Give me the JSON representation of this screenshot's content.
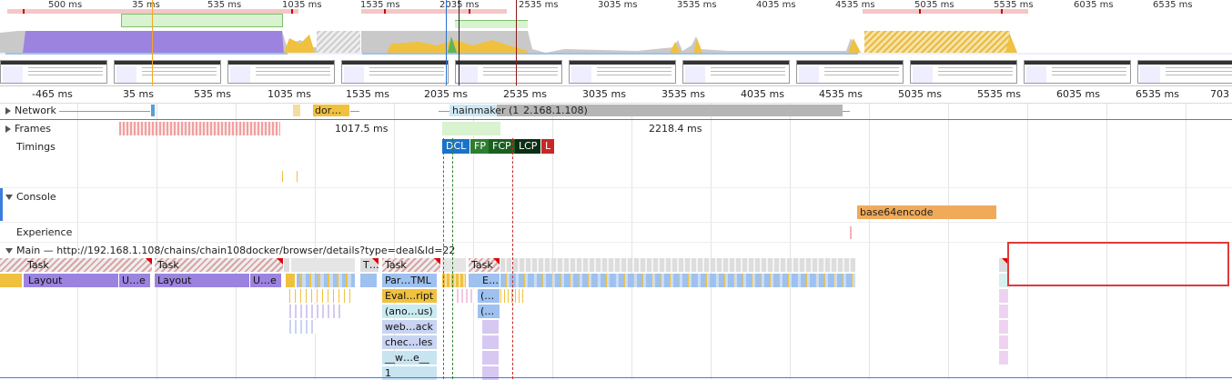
{
  "overview": {
    "ticks": [
      "500 ms",
      "35 ms",
      "535 ms",
      "1035 ms",
      "1535 ms",
      "2035 ms",
      "2535 ms",
      "3035 ms",
      "3535 ms",
      "4035 ms",
      "4535 ms",
      "5035 ms",
      "5535 ms",
      "6035 ms",
      "6535 ms"
    ]
  },
  "ruler": {
    "ticks": [
      "-465 ms",
      "35 ms",
      "535 ms",
      "1035 ms",
      "1535 ms",
      "2035 ms",
      "2535 ms",
      "3035 ms",
      "3535 ms",
      "4035 ms",
      "4535 ms",
      "5035 ms",
      "5535 ms",
      "6035 ms",
      "6535 ms",
      "703"
    ]
  },
  "tracks": {
    "network": {
      "label": "Network",
      "req1": "dor…",
      "req2": "hainmaker (1",
      "req3": "2.168.1.108)"
    },
    "frames": {
      "label": "Frames",
      "frame1": "1017.5 ms",
      "frame2": "2218.4 ms"
    },
    "timings": {
      "label": "Timings",
      "markers": [
        {
          "label": "DCL",
          "color": "#1a73c9"
        },
        {
          "label": "FP",
          "color": "#2e7d32"
        },
        {
          "label": "FCP",
          "color": "#1b5e20"
        },
        {
          "label": "LCP",
          "color": "#0d2e14"
        },
        {
          "label": "L",
          "color": "#c62828"
        }
      ]
    },
    "console": {
      "label": "Console",
      "event": "base64encode"
    },
    "experience": {
      "label": "Experience"
    },
    "main": {
      "label": "Main — http://192.168.1.108/chains/chain108docker/browser/details?type=deal&Id=22"
    }
  },
  "flame": {
    "task1": "Task",
    "task2": "Task",
    "task3": "T…",
    "task4": "Task",
    "task5": "Task",
    "layout1": "Layout",
    "layout1b": "U…e",
    "layout2": "Layout",
    "layout2b": "U…e",
    "parse": "Par…TML",
    "eval": "Eval…ript",
    "anon": "(ano…us)",
    "webpack": "web…ack",
    "check": "chec…les",
    "w": "__w…e__",
    "one": "1",
    "e": "E…",
    "p1": "(…",
    "p2": "(…"
  },
  "colors": {
    "scripting": "#f0c13e",
    "rendering": "#9c83e0",
    "loading": "#9ec1ef",
    "selection_box": "#e03a3a",
    "console_event": "#f0aa5a"
  }
}
